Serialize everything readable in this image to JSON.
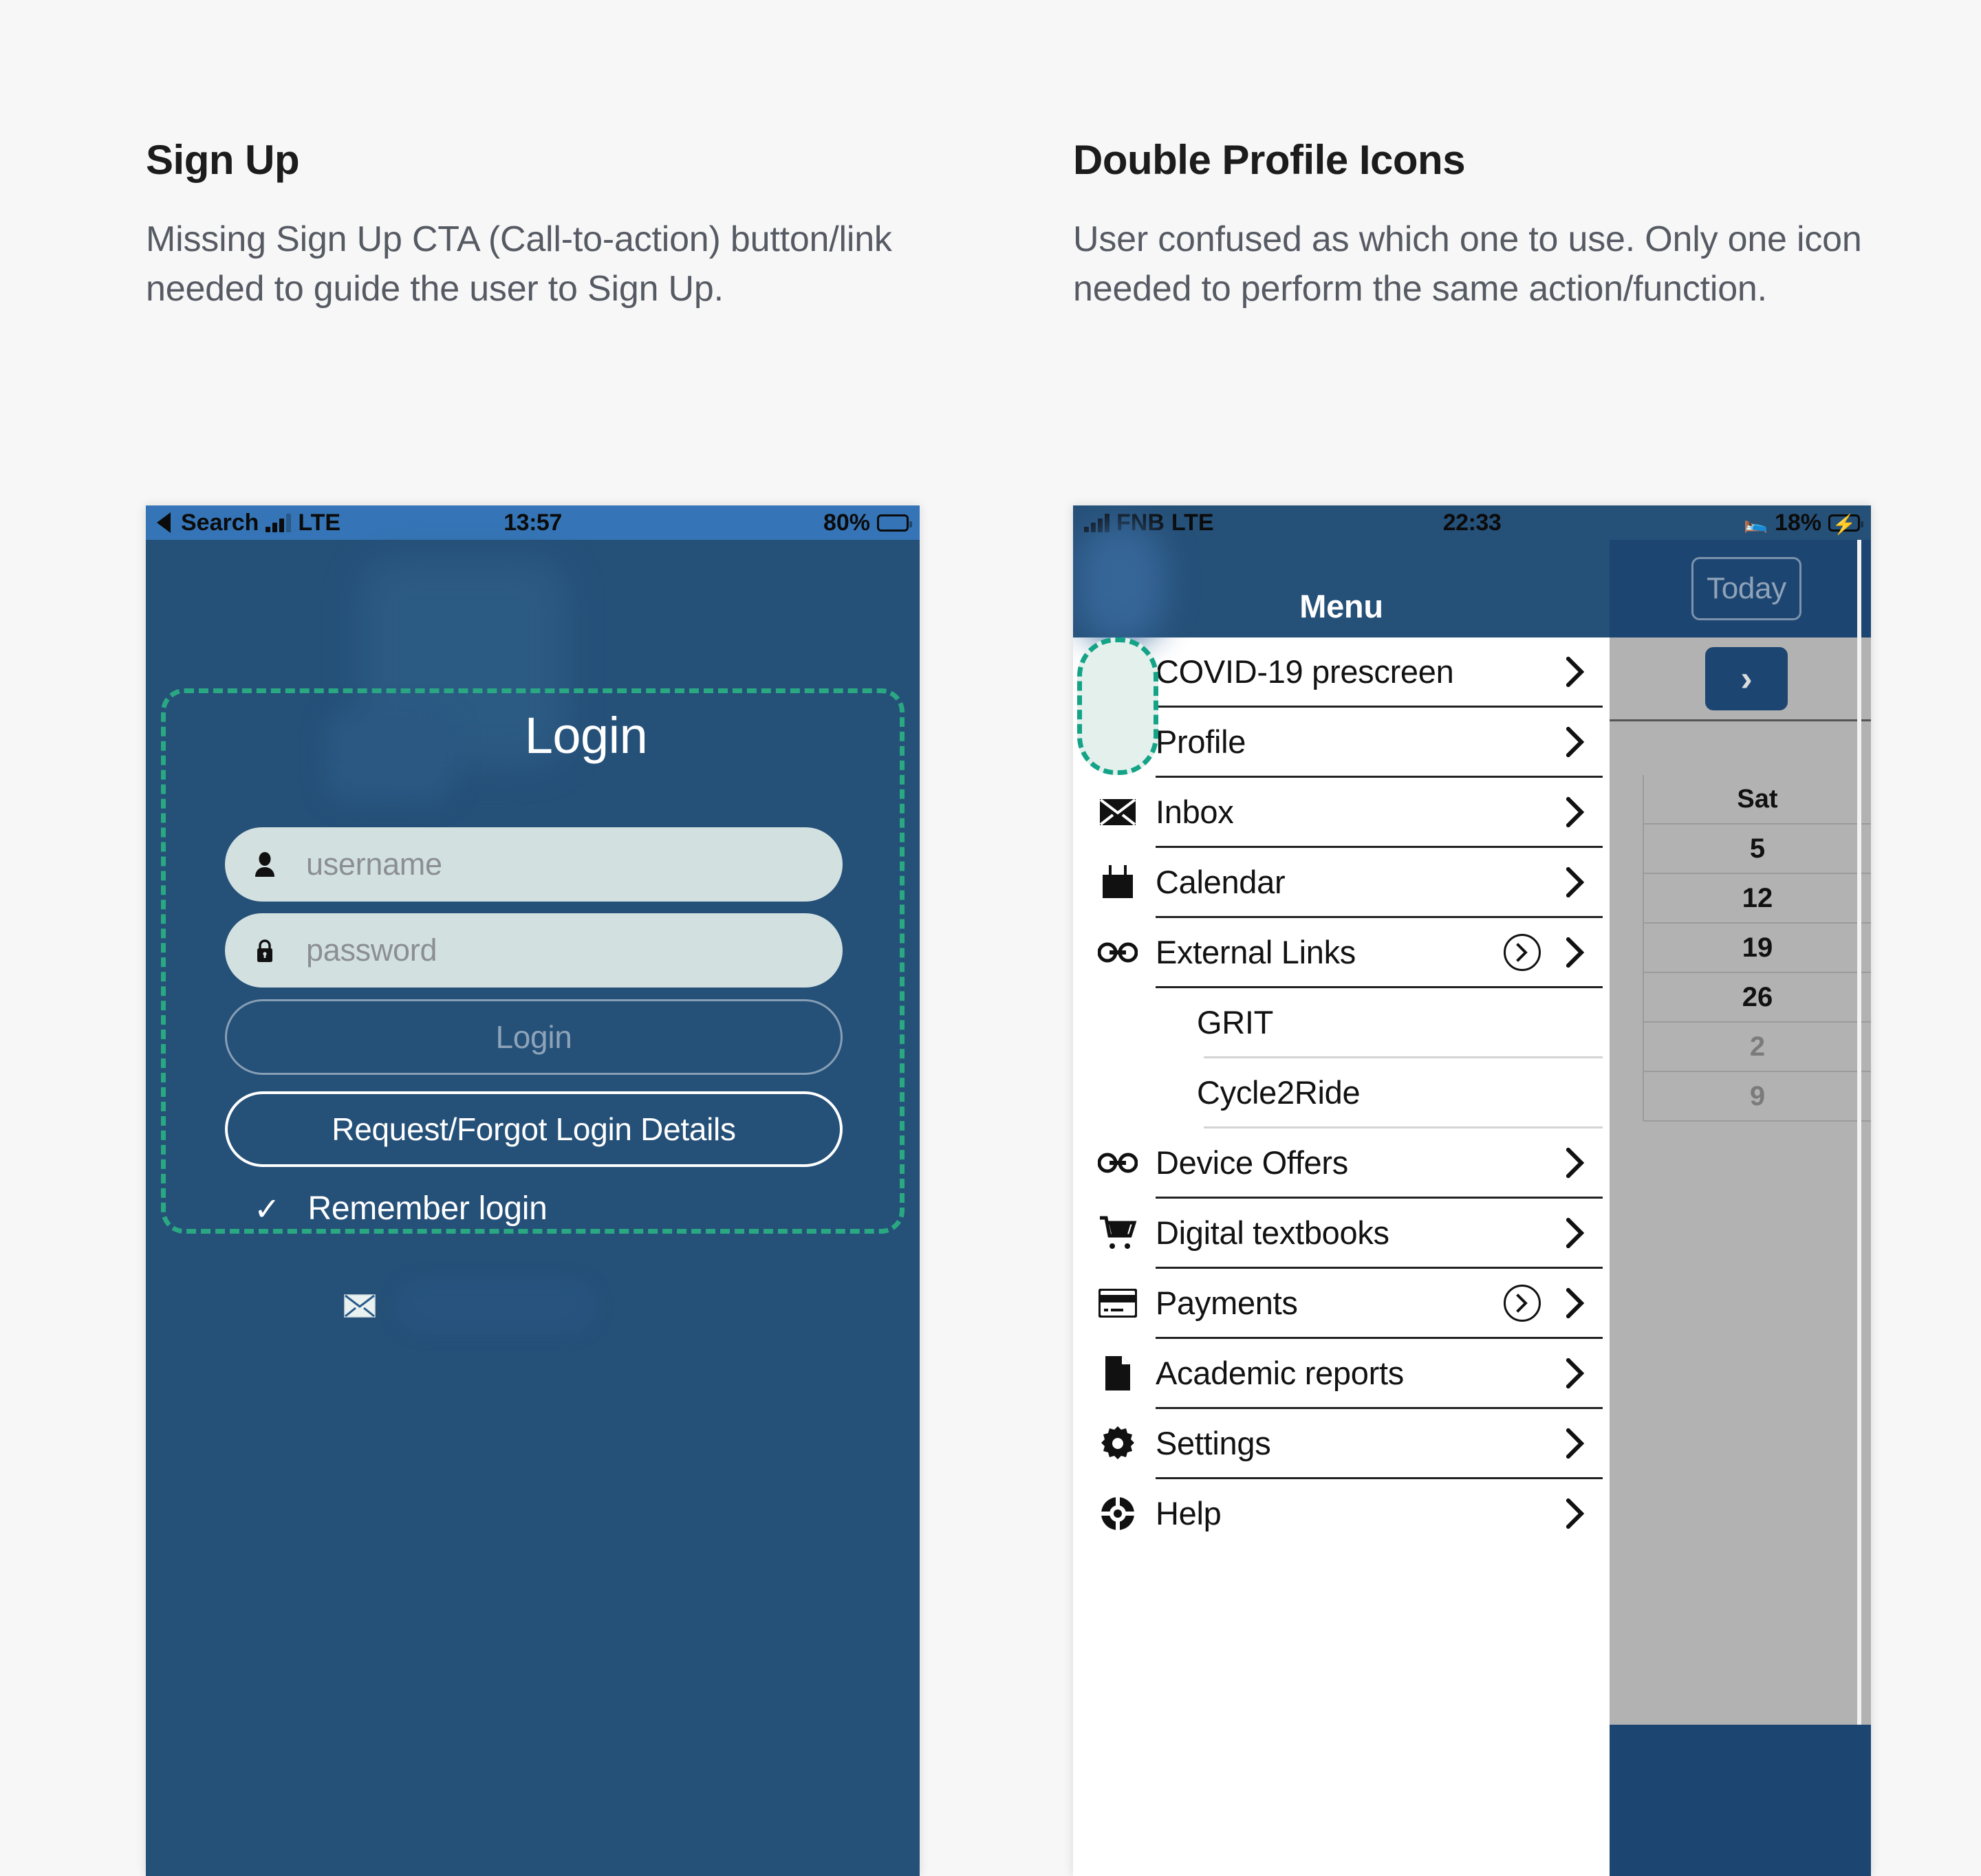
{
  "annotations": [
    {
      "title": "Sign Up",
      "body": "Missing Sign Up CTA (Call-to-action) button/link needed to guide the user to Sign Up."
    },
    {
      "title": "Double Profile Icons",
      "body": "User confused as which one to use. Only one icon needed to perform the same action/function."
    }
  ],
  "login_screen": {
    "status_bar": {
      "back_label": "Search",
      "carrier": "LTE",
      "time": "13:57",
      "battery_percent": "80%"
    },
    "title": "Login",
    "username_placeholder": "username",
    "password_placeholder": "password",
    "login_button": "Login",
    "forgot_button": "Request/Forgot Login Details",
    "remember_check": "✓",
    "remember_label": "Remember login"
  },
  "menu_screen": {
    "status_bar": {
      "carrier": "FNB",
      "network": "LTE",
      "time": "22:33",
      "battery_percent": "18%"
    },
    "header_title": "Menu",
    "items": [
      {
        "label": "COVID-19 prescreen",
        "icon": "person-icon",
        "chevron": "›",
        "extra_chevron": false,
        "sub": false
      },
      {
        "label": "Profile",
        "icon": "person-icon",
        "chevron": "›",
        "extra_chevron": false,
        "sub": false
      },
      {
        "label": "Inbox",
        "icon": "envelope-icon",
        "chevron": "›",
        "extra_chevron": false,
        "sub": false
      },
      {
        "label": "Calendar",
        "icon": "calendar-icon",
        "chevron": "›",
        "extra_chevron": false,
        "sub": false
      },
      {
        "label": "External Links",
        "icon": "link-icon",
        "chevron": "›",
        "extra_chevron": true,
        "sub": false
      },
      {
        "label": "GRIT",
        "icon": "none",
        "chevron": "",
        "extra_chevron": false,
        "sub": true
      },
      {
        "label": "Cycle2Ride",
        "icon": "none",
        "chevron": "",
        "extra_chevron": false,
        "sub": true
      },
      {
        "label": "Device Offers",
        "icon": "link-icon",
        "chevron": "›",
        "extra_chevron": false,
        "sub": false
      },
      {
        "label": "Digital textbooks",
        "icon": "cart-icon",
        "chevron": "›",
        "extra_chevron": false,
        "sub": false
      },
      {
        "label": "Payments",
        "icon": "card-icon",
        "chevron": "›",
        "extra_chevron": true,
        "sub": false
      },
      {
        "label": "Academic reports",
        "icon": "document-icon",
        "chevron": "›",
        "extra_chevron": false,
        "sub": false
      },
      {
        "label": "Settings",
        "icon": "gear-icon",
        "chevron": "›",
        "extra_chevron": false,
        "sub": false
      },
      {
        "label": "Help",
        "icon": "lifebuoy-icon",
        "chevron": "›",
        "extra_chevron": false,
        "sub": false
      }
    ]
  },
  "calendar_strip": {
    "today_label": "Today",
    "next_label": "›",
    "day_header": "Sat",
    "dates": [
      {
        "value": "5",
        "muted": false
      },
      {
        "value": "12",
        "muted": false
      },
      {
        "value": "19",
        "muted": false
      },
      {
        "value": "26",
        "muted": false
      },
      {
        "value": "2",
        "muted": true
      },
      {
        "value": "9",
        "muted": true
      }
    ]
  },
  "colors": {
    "page_bg": "#f7f7f7",
    "phone_blue": "#255078",
    "status_blue": "#3575b7",
    "highlight_teal": "#14a387",
    "highlight_fill": "#e3f0ec",
    "field_bg": "#d3e0e0",
    "battery_low_red": "#f0433a",
    "calendar_grey": "#b2b2b2"
  }
}
